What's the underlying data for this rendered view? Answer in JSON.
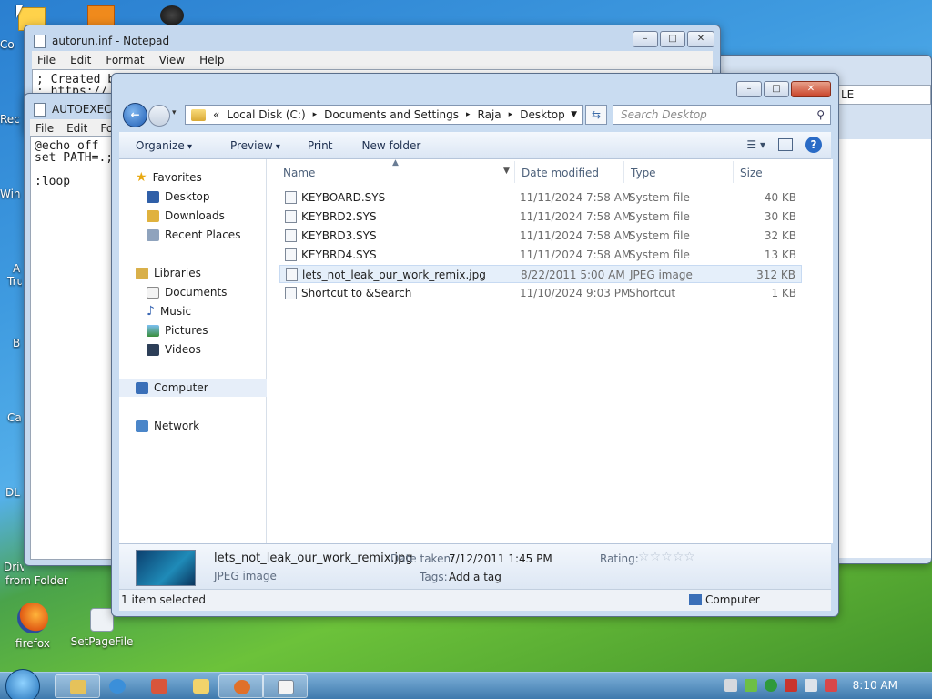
{
  "desktop": {
    "icons": [
      {
        "label": "firefox",
        "icon": "firefox-icon"
      },
      {
        "label": "SetPageFile",
        "icon": "setpagefile-icon"
      }
    ],
    "left_labels": [
      "Co",
      "Rec",
      "Win",
      "A",
      "Tru",
      "B",
      "Ca",
      "DL",
      "Driv",
      "from Folder"
    ]
  },
  "notepad1": {
    "title": "autorun.inf - Notepad",
    "menu": [
      "File",
      "Edit",
      "Format",
      "View",
      "Help"
    ],
    "lines": [
      "; Created b",
      "; https://"
    ]
  },
  "notepad2": {
    "title": "AUTOEXEC.B",
    "menu": [
      "File",
      "Edit",
      "For"
    ],
    "lines": [
      "@echo off",
      "set PATH=.;",
      "",
      ":loop"
    ]
  },
  "background_window": {
    "fragment": "LE"
  },
  "explorer": {
    "breadcrumb": {
      "overflow": "«",
      "segments": [
        "Local Disk (C:)",
        "Documents and Settings",
        "Raja",
        "Desktop"
      ],
      "separator": "▸"
    },
    "search_placeholder": "Search Desktop",
    "commands": [
      "Organize",
      "Preview",
      "Print",
      "New folder"
    ],
    "nav": {
      "favorites": {
        "label": "Favorites",
        "items": [
          "Desktop",
          "Downloads",
          "Recent Places"
        ]
      },
      "libraries": {
        "label": "Libraries",
        "items": [
          "Documents",
          "Music",
          "Pictures",
          "Videos"
        ]
      },
      "computer": "Computer",
      "network": "Network"
    },
    "columns": [
      "Name",
      "Date modified",
      "Type",
      "Size"
    ],
    "files": [
      {
        "name": "KEYBOARD.SYS",
        "date": "11/11/2024 7:58 AM",
        "type": "System file",
        "size": "40 KB"
      },
      {
        "name": "KEYBRD2.SYS",
        "date": "11/11/2024 7:58 AM",
        "type": "System file",
        "size": "30 KB"
      },
      {
        "name": "KEYBRD3.SYS",
        "date": "11/11/2024 7:58 AM",
        "type": "System file",
        "size": "32 KB"
      },
      {
        "name": "KEYBRD4.SYS",
        "date": "11/11/2024 7:58 AM",
        "type": "System file",
        "size": "13 KB"
      },
      {
        "name": "lets_not_leak_our_work_remix.jpg",
        "date": "8/22/2011 5:00 AM",
        "type": "JPEG image",
        "size": "312 KB"
      },
      {
        "name": "Shortcut to &Search",
        "date": "11/10/2024 9:03 PM",
        "type": "Shortcut",
        "size": "1 KB"
      }
    ],
    "selected_index": 4,
    "details": {
      "filename": "lets_not_leak_our_work_remix.jpg",
      "filetype": "JPEG image",
      "date_taken_label": "Date taken:",
      "date_taken": "7/12/2011 1:45 PM",
      "tags_label": "Tags:",
      "tags_value": "Add a tag",
      "rating_label": "Rating:",
      "rating_value": 0,
      "rating_max": 5
    },
    "status": {
      "selection": "1 item selected",
      "location": "Computer"
    }
  },
  "taskbar": {
    "clock": "8:10 AM"
  },
  "colors": {
    "accent": "#2a6bc6",
    "selection": "#e5effa",
    "taskbar": "#3f79ad"
  }
}
